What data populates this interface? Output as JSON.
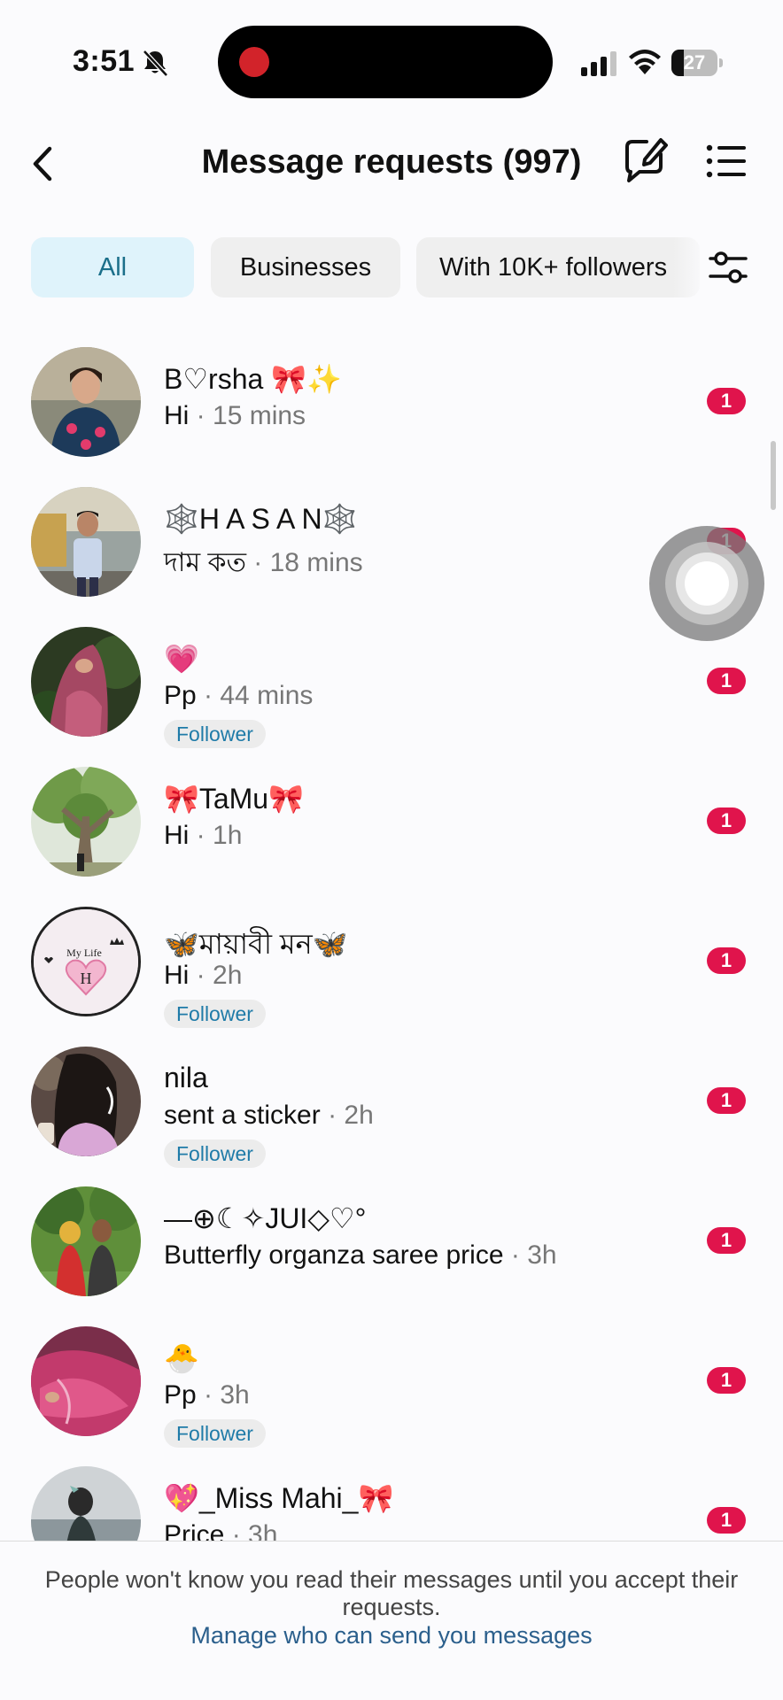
{
  "status_bar": {
    "time": "3:51",
    "battery": "27",
    "battery_level": 0.27
  },
  "header": {
    "title": "Message requests (997)"
  },
  "filters": {
    "chips": [
      "All",
      "Businesses",
      "With 10K+ followers"
    ],
    "active": "All"
  },
  "requests": [
    {
      "name": "B♡rsha 🎀✨",
      "message": "Hi",
      "time": " · 15 mins",
      "follower": "",
      "unread": "1"
    },
    {
      "name": "🕸️H A S A N🕸️",
      "message": "দাম কত",
      "time": " · 18 mins",
      "follower": "",
      "unread": "1"
    },
    {
      "name": "💗",
      "message": "Pp",
      "time": " · 44 mins",
      "follower": "Follower",
      "unread": "1"
    },
    {
      "name": "🎀TaMu🎀",
      "message": "Hi",
      "time": " · 1h",
      "follower": "",
      "unread": "1"
    },
    {
      "name": "🦋মায়াবী মন🦋",
      "message": "Hi",
      "time": " · 2h",
      "follower": "Follower",
      "unread": "1"
    },
    {
      "name": "nila",
      "message": "sent a sticker",
      "time": " · 2h",
      "follower": "Follower",
      "unread": "1"
    },
    {
      "name": "⎯⎯⊕☾✧JUI◇♡°",
      "message": "Butterfly organza saree price",
      "time": " · 3h",
      "follower": "",
      "unread": "1"
    },
    {
      "name": "🐣",
      "message": "Pp",
      "time": " · 3h",
      "follower": "Follower",
      "unread": "1"
    },
    {
      "name": "💖_Miss Mahi_🎀",
      "message": "Price",
      "time": " · 3h",
      "follower": "",
      "unread": "1"
    }
  ],
  "avatar_5_text": {
    "line1": "My Life",
    "letter": "H"
  },
  "footer": {
    "note": "People won't know you read their messages until you accept their requests.",
    "link": "Manage who can send you messages"
  },
  "colors": {
    "badge": "#e0144c",
    "active_chip_bg": "#dff3fb",
    "active_chip_text": "#1b6f8a",
    "follower_text": "#1f7ba8",
    "link": "#2b5f8c"
  },
  "icons": [
    "bell-slash-icon",
    "signal-icon",
    "wifi-icon",
    "battery-icon",
    "back-chevron-icon",
    "compose-edit-icon",
    "list-icon",
    "filter-sliders-icon"
  ]
}
